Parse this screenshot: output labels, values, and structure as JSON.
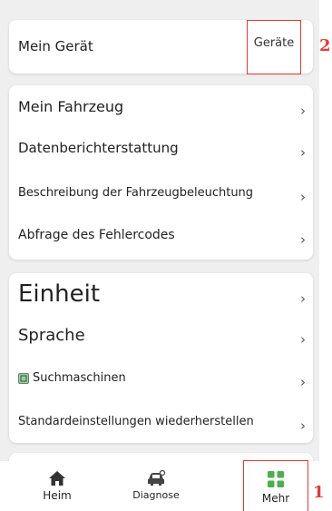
{
  "device": {
    "title": "Mein Gerät",
    "devices_link": "Geräte"
  },
  "vehicle_menu": [
    {
      "label": "Mein Fahrzeug"
    },
    {
      "label": "Datenberichterstattung"
    },
    {
      "label": "Beschreibung der Fahrzeugbeleuchtung"
    },
    {
      "label": "Abfrage des Fehlercodes"
    }
  ],
  "settings_menu": [
    {
      "label": "Einheit"
    },
    {
      "label": "Sprache"
    },
    {
      "label": "Suchmaschinen"
    },
    {
      "label": "Standardeinstellungen wiederherstellen"
    }
  ],
  "chevron": "›",
  "tabbar": {
    "tabs": [
      {
        "label": "Heim",
        "icon": "home-icon"
      },
      {
        "label": "Diagnose",
        "icon": "car-diagnose-icon"
      },
      {
        "label": "Mehr",
        "icon": "grid-icon",
        "active": true
      }
    ]
  },
  "annotations": {
    "devices_marker": "2",
    "more_marker": "1"
  },
  "colors": {
    "background": "#efefef",
    "active_tab": "#4caf50",
    "annotation_red": "#e53935"
  }
}
